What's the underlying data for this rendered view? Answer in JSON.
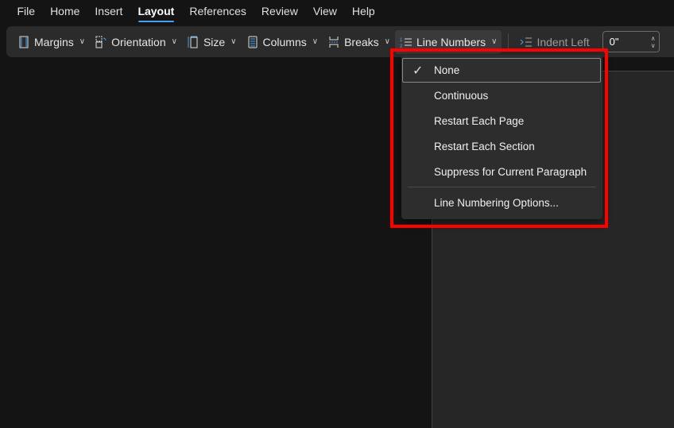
{
  "menubar": {
    "items": [
      "File",
      "Home",
      "Insert",
      "Layout",
      "References",
      "Review",
      "View",
      "Help"
    ],
    "active": "Layout"
  },
  "toolbar": {
    "margins": "Margins",
    "orientation": "Orientation",
    "size": "Size",
    "columns": "Columns",
    "breaks": "Breaks",
    "line_numbers": "Line Numbers",
    "indent_left": "Indent Left",
    "indent_left_value": "0\""
  },
  "dropdown": {
    "items": [
      {
        "label": "None",
        "checked": true
      },
      {
        "label": "Continuous"
      },
      {
        "label": "Restart Each Page"
      },
      {
        "label": "Restart Each Section"
      },
      {
        "label": "Suppress for Current Paragraph"
      }
    ],
    "options": "Line Numbering Options..."
  },
  "colors": {
    "accent": "#4aa0f0",
    "highlight": "#ff0000",
    "background": "#141414",
    "toolbar": "#2b2b2b"
  }
}
